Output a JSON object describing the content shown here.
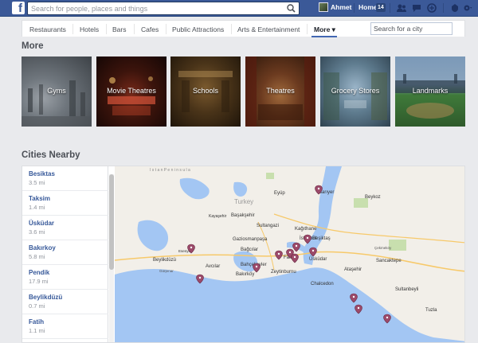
{
  "topbar": {
    "logo": "f",
    "search_placeholder": "Search for people, places and things",
    "user_name": "Ahmet",
    "home_label": "Home",
    "home_badge": "14"
  },
  "categories": [
    {
      "label": "Restaurants"
    },
    {
      "label": "Hotels"
    },
    {
      "label": "Bars"
    },
    {
      "label": "Cafes"
    },
    {
      "label": "Public Attractions"
    },
    {
      "label": "Arts & Entertainment"
    },
    {
      "label": "More ▾"
    }
  ],
  "city_search_placeholder": "Search for a city",
  "more": {
    "title": "More",
    "tiles": [
      {
        "label": "Gyms"
      },
      {
        "label": "Movie Theatres"
      },
      {
        "label": "Schools"
      },
      {
        "label": "Theatres"
      },
      {
        "label": "Grocery Stores"
      },
      {
        "label": "Landmarks"
      }
    ]
  },
  "cities_nearby": {
    "title": "Cities Nearby",
    "items": [
      {
        "name": "Besiktas",
        "distance": "3.5 mi"
      },
      {
        "name": "Taksim",
        "distance": "1.4 mi"
      },
      {
        "name": "Üsküdar",
        "distance": "3.6 mi"
      },
      {
        "name": "Bakırkoy",
        "distance": "5.8 mi"
      },
      {
        "name": "Pendik",
        "distance": "17.9 mi"
      },
      {
        "name": "Beylikdüzü",
        "distance": "0.7 mi"
      },
      {
        "name": "Fatih",
        "distance": "1.1 mi"
      }
    ]
  },
  "map": {
    "labels": {
      "peninsula": "I s t a n P e n i n s u l a",
      "turkey": "Turkey",
      "eyup": "Eyüp",
      "sariyer": "Sarıyer",
      "beykoz": "Beykoz",
      "kayasehir": "Kayaşehir",
      "basaksehir": "Başakşehir",
      "sultangazi": "Sultangazi",
      "kagithane": "Kağıthane",
      "gaziosmanpasa": "Gaziosmanpaşa",
      "istanbul": "İstanbul",
      "besiktas": "Beşiktaş",
      "esenyurt": "Esenyurt",
      "bagcilar": "Bağcılar",
      "fatih": "Fatih",
      "uskudar": "Üsküdar",
      "cekmekoy": "Çekmeköy",
      "beylikduzu": "Beylikdüzü",
      "gurpinar": "Gürpınar",
      "avcilar": "Avcılar",
      "bahcelievler": "Bahçelievler",
      "zeytinburnu": "Zeytinburnu",
      "atasehir": "Ataşehir",
      "sancaktepe": "Sancaktepe",
      "bakirkoy": "Bakırköy",
      "chalcedon": "Chalcedon",
      "sultanbeyli": "Sultanbeyli",
      "tuzla": "Tuzla"
    }
  },
  "colors": {
    "brand": "#3b5998",
    "link": "#365899",
    "map_land": "#f2efe9",
    "map_water": "#a3c6f3",
    "pin": "#9c4a6a"
  }
}
